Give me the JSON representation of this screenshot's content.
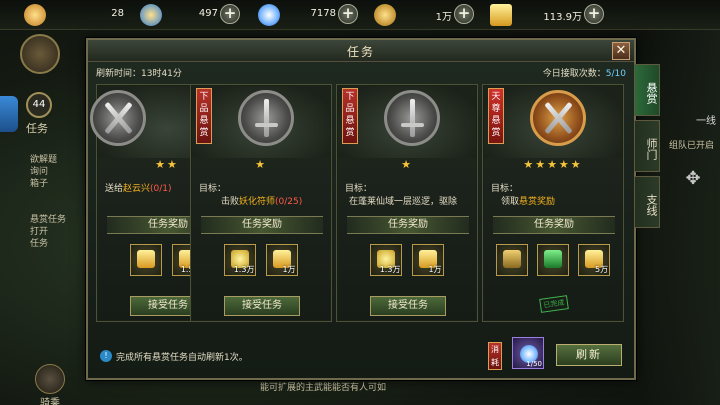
{
  "currencies": [
    {
      "name": "gold-ingot",
      "value": "28",
      "color": "#e8b44a"
    },
    {
      "name": "spirit-coin",
      "value": "497",
      "color": "#2a7ad8"
    },
    {
      "name": "jade-disc",
      "value": "7178",
      "color": "#6fb0ff"
    },
    {
      "name": "copper-coin",
      "value": "1万",
      "color": "#d8a020"
    },
    {
      "name": "ticket",
      "value": "113.9万",
      "color": "#f0c830"
    }
  ],
  "background": {
    "level": "44",
    "quest_label": "任务",
    "quest_lines": [
      "欲解题",
      "询问",
      "箱子",
      "悬赏任务",
      "打开",
      "任务"
    ],
    "right_text_top": "一线",
    "right_text": "组队已开启",
    "mount_label": "骑乘",
    "bottom_text": "能可扩展的主武能能否有人可如"
  },
  "dialog": {
    "title": "任务",
    "refresh_time_label": "刷新时间：13时41分",
    "accept_count_label": "今日接取次数：",
    "accept_count_value": "5/10",
    "tabs": [
      "悬赏",
      "师门",
      "支线"
    ],
    "cards": [
      {
        "badge": "",
        "stars": "★★",
        "target_prefix": "",
        "target_text": "送给",
        "target_highlight": "赵云兴",
        "target_progress": "(0/1)",
        "reward_title": "任务奖励",
        "items": [
          {
            "qty": "",
            "color": "#f0c830"
          },
          {
            "qty": "1.5万",
            "color": "#f0c830"
          }
        ],
        "button": "接受任务"
      },
      {
        "badge": "下品悬赏",
        "stars": "★",
        "target_prefix": "目标：",
        "target_text": "击败",
        "target_highlight": "妖化符师",
        "target_progress": "(0/25)",
        "reward_title": "任务奖励",
        "items": [
          {
            "qty": "1.3万",
            "color": "#e8d040"
          },
          {
            "qty": "1万",
            "color": "#f0c830"
          }
        ],
        "button": "接受任务"
      },
      {
        "badge": "下品悬赏",
        "stars": "★",
        "target_prefix": "目标：",
        "target_text": "在蓬莱仙域一层巡逻，驱除",
        "target_highlight": "",
        "target_progress": "",
        "reward_title": "任务奖励",
        "items": [
          {
            "qty": "1.3万",
            "color": "#e8d040"
          },
          {
            "qty": "1万",
            "color": "#f0c830"
          }
        ],
        "button": "接受任务"
      },
      {
        "badge": "天尊悬赏",
        "stars": "★★★★★",
        "target_prefix": "目标：",
        "target_text": "领取",
        "target_highlight": "悬赏奖励",
        "target_progress": "",
        "reward_title": "任务奖励",
        "items": [
          {
            "qty": "",
            "color": "#c8a040"
          },
          {
            "qty": "",
            "color": "#3ab050"
          },
          {
            "qty": "5万",
            "color": "#f0c830"
          },
          {
            "qty": "",
            "color": "#f0c830"
          }
        ],
        "button": "",
        "stamp": "已完成"
      }
    ],
    "note": "完成所有悬赏任务自动刷新1次。",
    "consume_label": "消耗",
    "cost_qty": "1/50",
    "refresh_button": "刷新"
  }
}
